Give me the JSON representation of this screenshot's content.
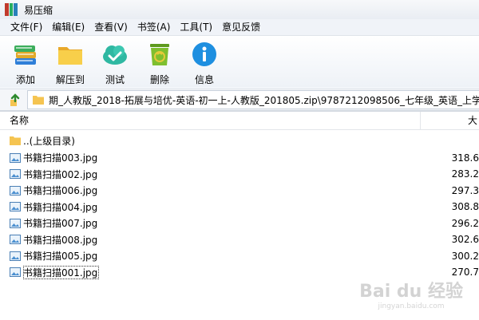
{
  "window": {
    "title": "易压缩"
  },
  "menu": [
    "文件(F)",
    "编辑(E)",
    "查看(V)",
    "书签(A)",
    "工具(T)",
    "意见反馈"
  ],
  "toolbar": {
    "add": "添加",
    "extract": "解压到",
    "test": "测试",
    "delete": "删除",
    "info": "信息"
  },
  "address": {
    "path": "期_人教版_2018-拓展与培优-英语-初一上-人教版_201805.zip\\9787212098506_七年级_英语_上学期_"
  },
  "list": {
    "col_name": "名称",
    "col_size": "大",
    "parent": "..(上级目录)",
    "files": [
      {
        "name": "书籍扫描003.jpg",
        "size": "318.6"
      },
      {
        "name": "书籍扫描002.jpg",
        "size": "283.2"
      },
      {
        "name": "书籍扫描006.jpg",
        "size": "297.3"
      },
      {
        "name": "书籍扫描004.jpg",
        "size": "308.8"
      },
      {
        "name": "书籍扫描007.jpg",
        "size": "296.2"
      },
      {
        "name": "书籍扫描008.jpg",
        "size": "302.6"
      },
      {
        "name": "书籍扫描005.jpg",
        "size": "300.2"
      },
      {
        "name": "书籍扫描001.jpg",
        "size": "270.7"
      }
    ]
  },
  "watermark": {
    "line1": "Bai du 经验",
    "line2": "jingyan.baidu.com"
  },
  "colors": {
    "folder": "#f5c451",
    "info_blue": "#1e8fe0",
    "test_teal": "#2fb8a2",
    "delete_green": "#7fbf2f",
    "extract_yellow": "#f6c338"
  }
}
